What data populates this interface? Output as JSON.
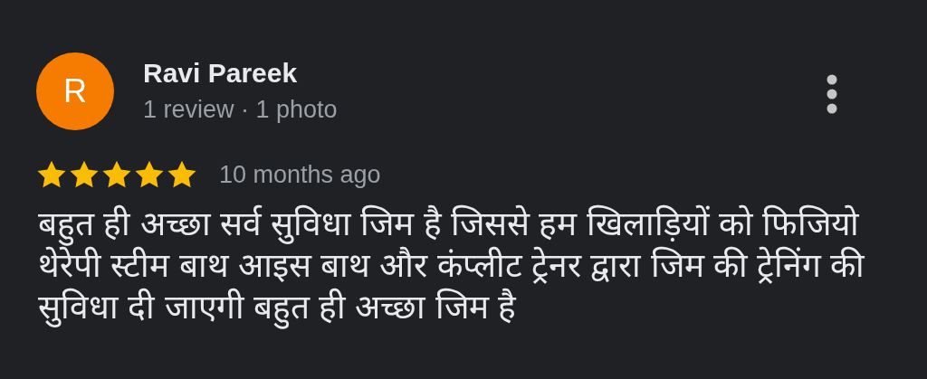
{
  "review": {
    "avatar_letter": "R",
    "author": "Ravi Pareek",
    "meta": "1 review · 1 photo",
    "stars": 5,
    "time": "10 months ago",
    "text": "बहुत ही अच्छा सर्व सुविधा जिम है जिससे हम खिलाड़ियों को फिजियो थेरेपी स्टीम बाथ आइस बाथ और कंप्लीट ट्रेनर द्वारा जिम की ट्रेनिंग की सुविधा दी जाएगी बहुत ही अच्छा जिम है"
  }
}
